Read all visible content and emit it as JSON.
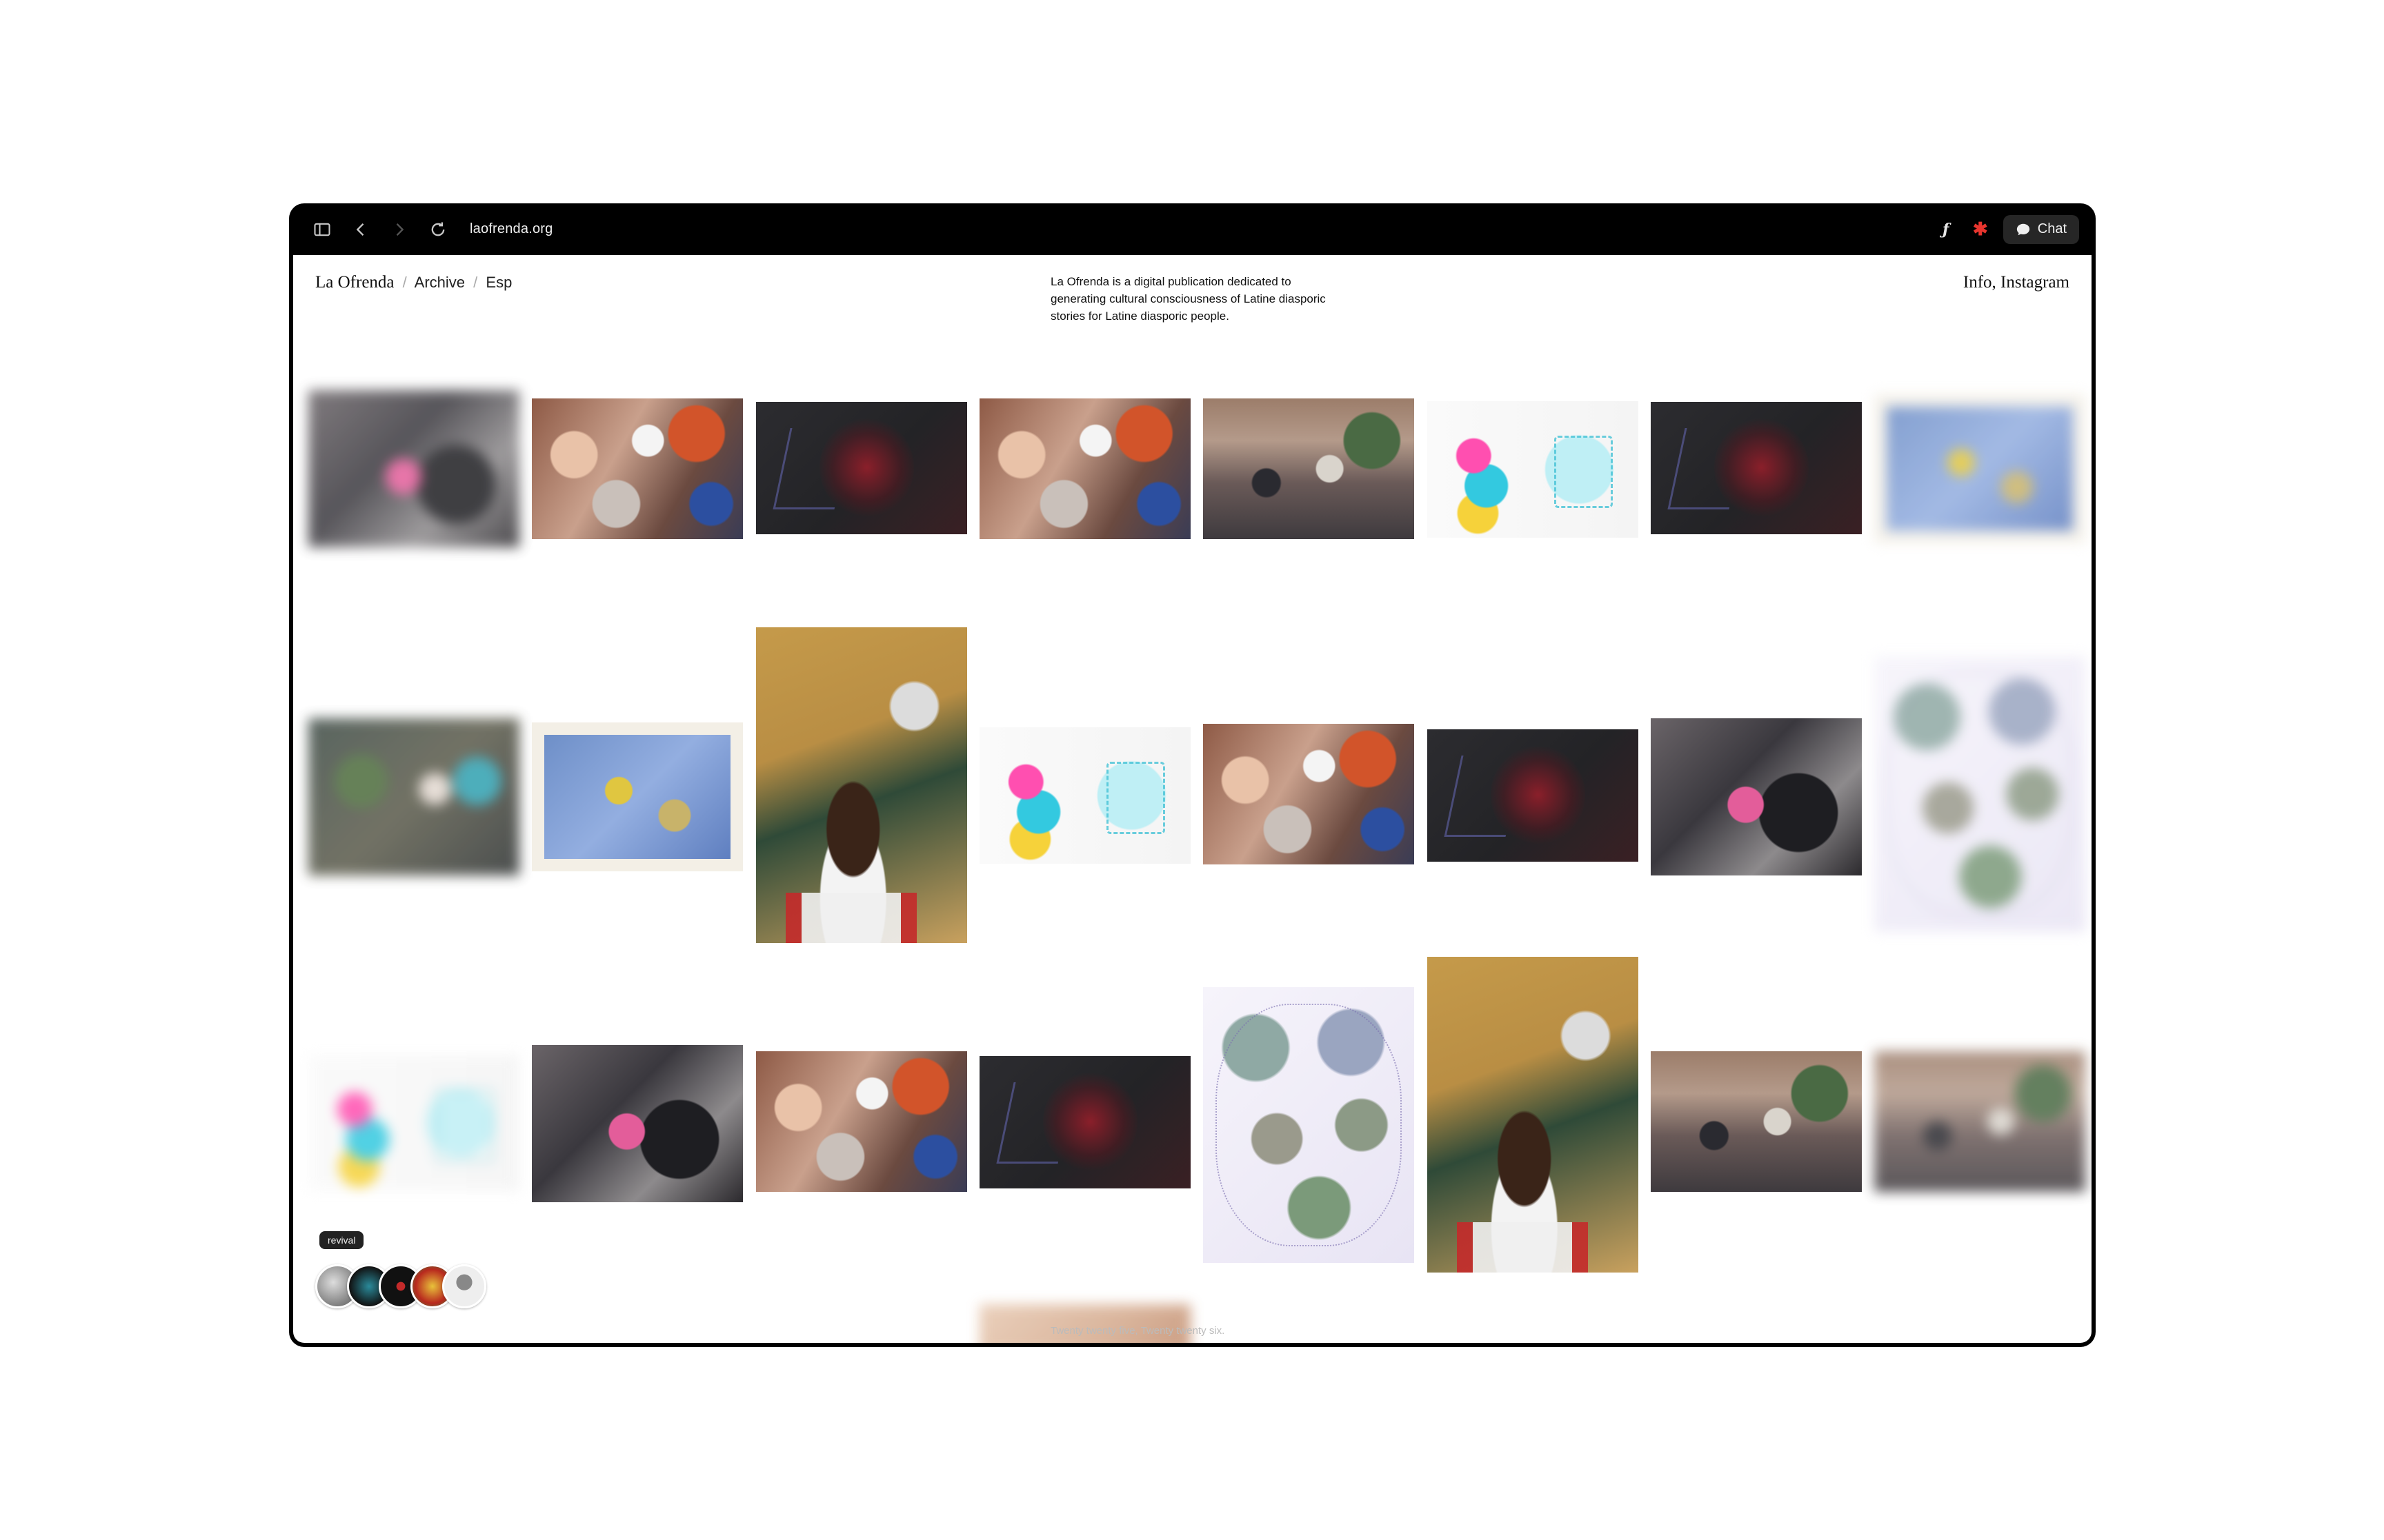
{
  "browser": {
    "url": "laofrenda.org",
    "chat_label": "Chat",
    "icons": [
      "sidebar-icon",
      "back-icon",
      "forward-icon",
      "reload-icon"
    ]
  },
  "site": {
    "brand": "La Ofrenda",
    "nav_archive": "Archive",
    "nav_esp": "Esp",
    "separator": "/",
    "tagline": "La Ofrenda is a digital publication dedicated to generating cultural consciousness of Latine diasporic stories for Latine diasporic people.",
    "nav_right": "Info, Instagram"
  },
  "tooltip": "revival",
  "caption": "Twenty twenty five, Twenty twenty six.",
  "colors": {
    "toolbar_bg": "#000000",
    "page_bg": "#ffffff",
    "text": "#111111"
  }
}
